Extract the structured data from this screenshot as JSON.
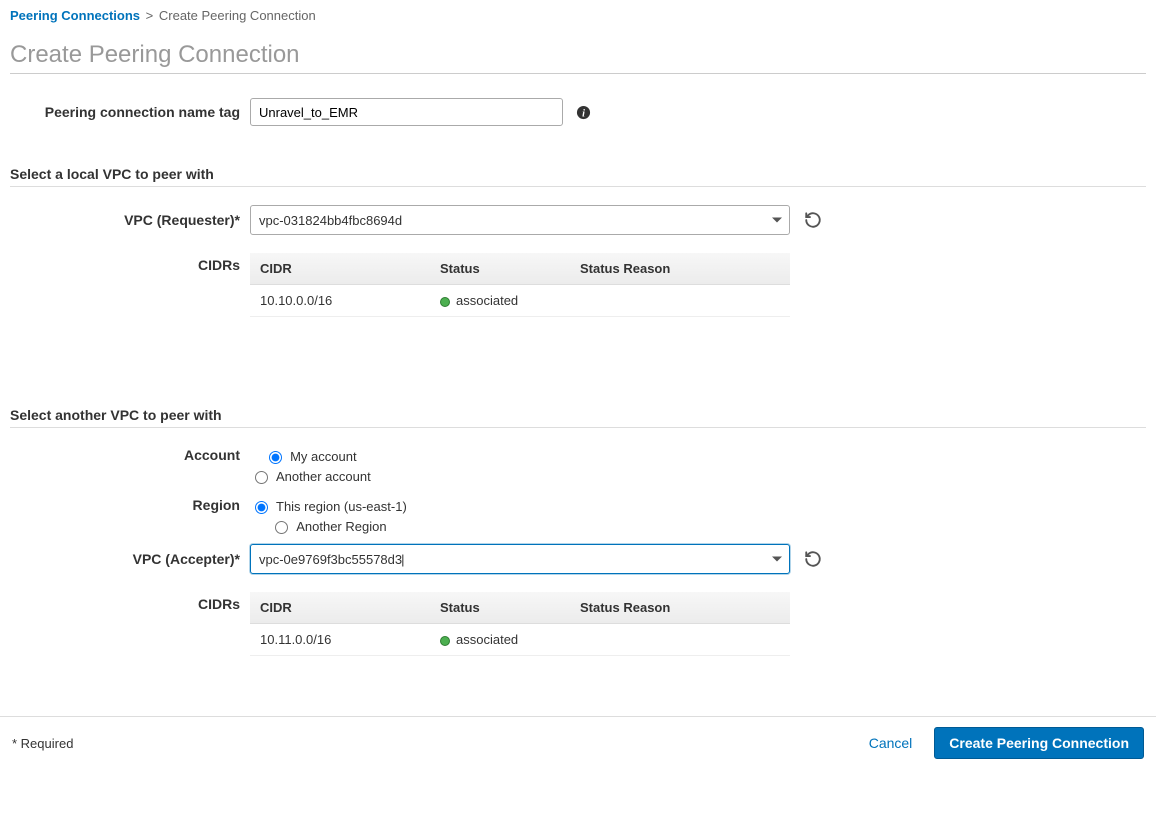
{
  "breadcrumb": {
    "parent": "Peering Connections",
    "current": "Create Peering Connection"
  },
  "page_title": "Create Peering Connection",
  "name_tag": {
    "label": "Peering connection name tag",
    "value": "Unravel_to_EMR"
  },
  "local_section": {
    "heading": "Select a local VPC to peer with",
    "vpc_label": "VPC (Requester)*",
    "vpc_value": "vpc-031824bb4fbc8694d",
    "cidrs_label": "CIDRs",
    "table_headers": {
      "cidr": "CIDR",
      "status": "Status",
      "reason": "Status Reason"
    },
    "rows": [
      {
        "cidr": "10.10.0.0/16",
        "status": "associated",
        "reason": ""
      }
    ]
  },
  "remote_section": {
    "heading": "Select another VPC to peer with",
    "account_label": "Account",
    "account_options": {
      "my": "My account",
      "other": "Another account"
    },
    "region_label": "Region",
    "region_options": {
      "this": "This region (us-east-1)",
      "other": "Another Region"
    },
    "vpc_label": "VPC (Accepter)*",
    "vpc_value": "vpc-0e9769f3bc55578d3",
    "cidrs_label": "CIDRs",
    "table_headers": {
      "cidr": "CIDR",
      "status": "Status",
      "reason": "Status Reason"
    },
    "rows": [
      {
        "cidr": "10.11.0.0/16",
        "status": "associated",
        "reason": ""
      }
    ]
  },
  "footer": {
    "required_note": "* Required",
    "cancel": "Cancel",
    "submit": "Create Peering Connection"
  }
}
